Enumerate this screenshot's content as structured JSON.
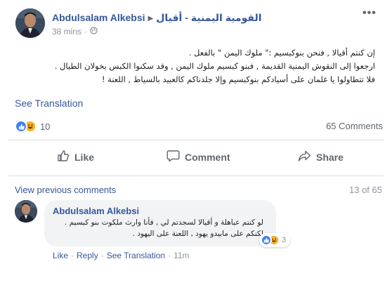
{
  "post": {
    "author": "Abdulsalam Alkebsi",
    "group": "القومية اليمنية - أقيال",
    "time": "38 mins",
    "text_lines": [
      "إن كنتم أقيالا , فنحن بنوكبسيم :\" ملوك اليمن \" بالفعل .",
      "ارجعوا إلى النقوش اليمنية القديمة , فبنو كبسيم ملوك اليمن , وقد سكنوا الكبس بخولان الطيال .",
      "فلا تتطاولوا يا غلمان على أسيادكم بنوكبسيم وإلا جلدناكم كالعبيد بالسياط , اللعنة !"
    ],
    "see_translation": "See Translation",
    "reactions_count": "10",
    "comments_count": "65 Comments",
    "actions": {
      "like": "Like",
      "comment": "Comment",
      "share": "Share"
    }
  },
  "comments_section": {
    "view_previous": "View previous comments",
    "page_count": "13 of 65",
    "comment": {
      "author": "Abdulsalam Alkebsi",
      "text_lines": [
        "لو كنتم عباهلة و أقيالا لسجدتم لي , فأنا وارث ملكوت بنو كبسيم .",
        "لكنكم على مابيدو يهود , اللعنة على اليهود ."
      ],
      "reactions_count": "3",
      "actions": {
        "like": "Like",
        "reply": "Reply",
        "see_translation": "See Translation",
        "time": "11m"
      }
    }
  },
  "colors": {
    "link": "#365899",
    "secondary_text": "#606770",
    "like_reaction": "#4080ff",
    "haha_reaction": "#f7b125"
  },
  "icons": [
    "more-icon",
    "globe-icon",
    "like-reaction-icon",
    "haha-reaction-icon",
    "thumbs-up-icon",
    "comment-bubble-icon",
    "share-arrow-icon"
  ]
}
